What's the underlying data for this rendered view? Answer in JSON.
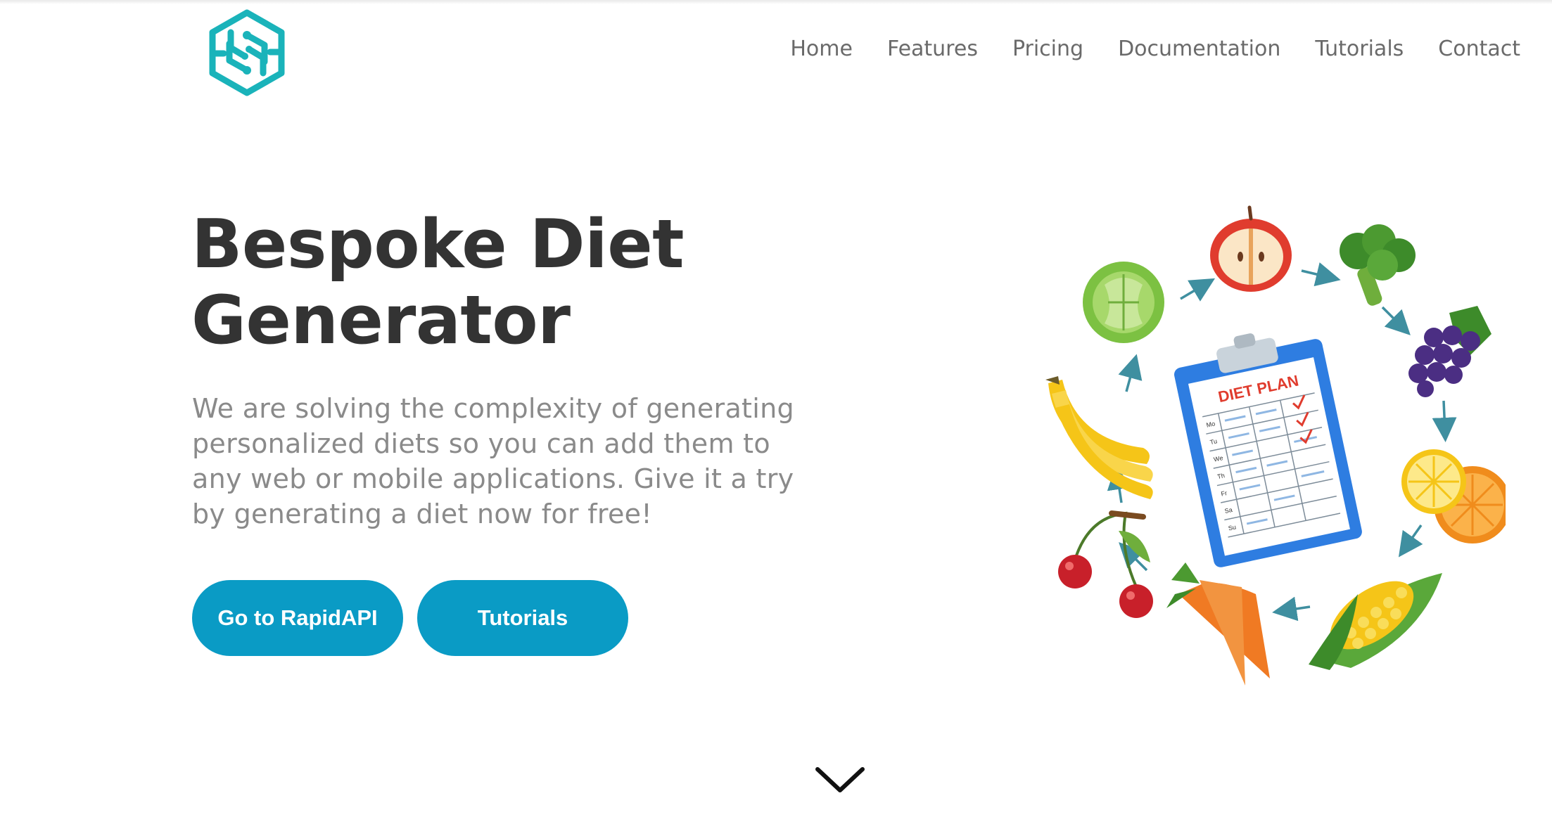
{
  "colors": {
    "accent": "#0a9bc5",
    "logo": "#1ab3ba",
    "title": "#333333",
    "subtitle": "#8a8a8a",
    "nav": "#6a6a6a"
  },
  "nav": {
    "items": [
      {
        "label": "Home"
      },
      {
        "label": "Features"
      },
      {
        "label": "Pricing"
      },
      {
        "label": "Documentation"
      },
      {
        "label": "Tutorials"
      },
      {
        "label": "Contact"
      }
    ]
  },
  "hero": {
    "title_line1": "Bespoke Diet",
    "title_line2": "Generator",
    "subtitle": "We are solving the complexity of generating personalized diets so you can add them to any web or mobile applications. Give it a try by generating a diet now for free!",
    "primary_button": "Go to RapidAPI",
    "secondary_button": "Tutorials"
  },
  "illustration": {
    "clipboard_title": "DIET PLAN",
    "day_labels": [
      "Mo",
      "Tu",
      "We",
      "Th",
      "Fr",
      "Sa",
      "Su"
    ]
  },
  "icons": {
    "logo": "hexagon-circuit-logo",
    "scroll": "chevron-down-icon"
  }
}
